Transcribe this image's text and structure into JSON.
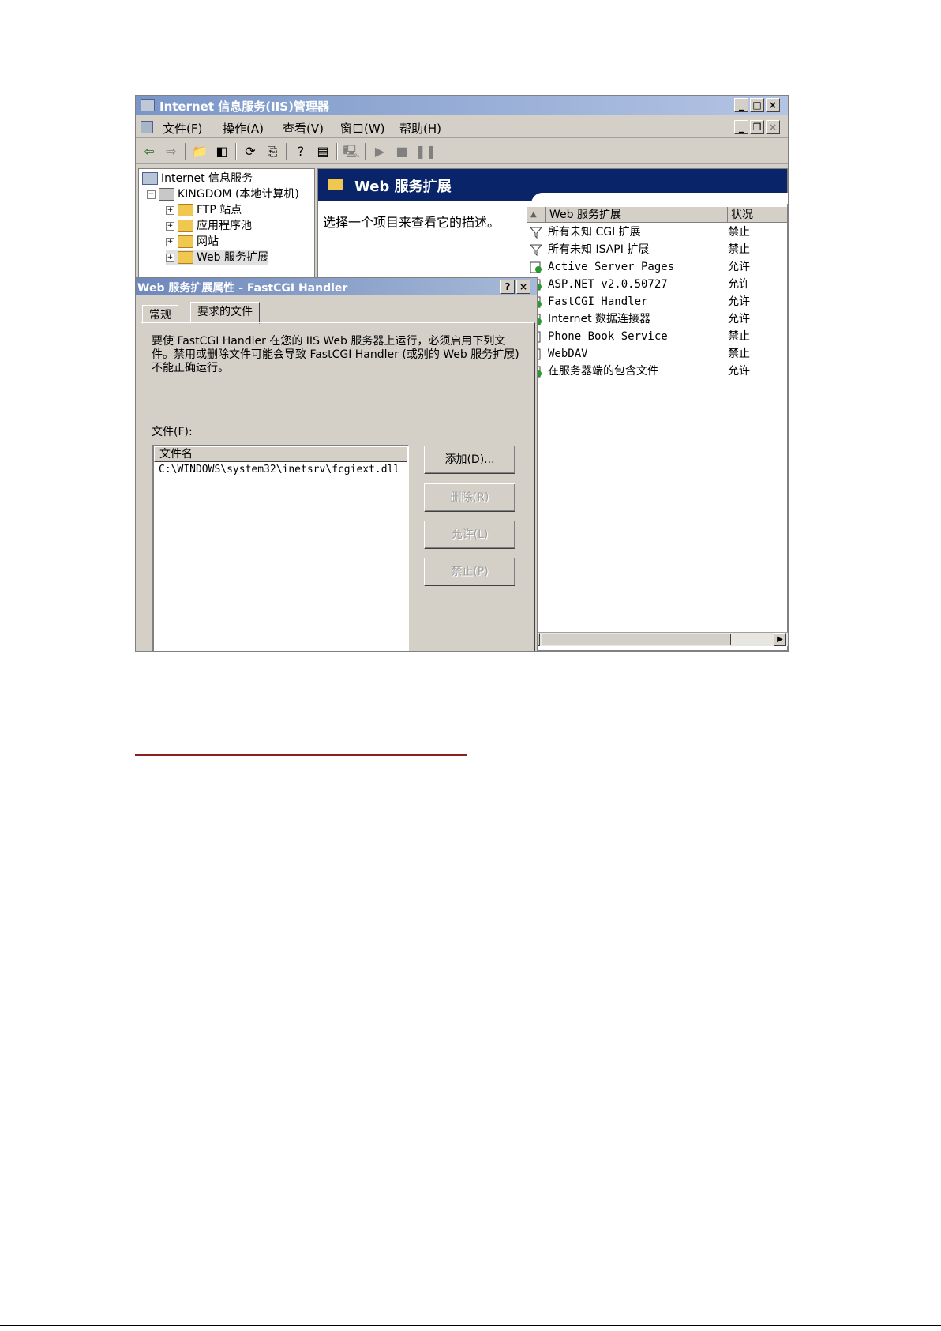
{
  "main_window": {
    "title": "Internet 信息服务(IIS)管理器",
    "caption_buttons": {
      "minimize": "_",
      "maximize": "□",
      "close": "×"
    },
    "mdi_buttons": {
      "minimize": "_",
      "restore": "❐",
      "close": "×"
    },
    "menu": [
      "文件(F)",
      "操作(A)",
      "查看(V)",
      "窗口(W)",
      "帮助(H)"
    ],
    "toolbar_icons": [
      "back-icon",
      "forward-icon",
      "up-folder-icon",
      "show-hide-tree-icon",
      "refresh-icon",
      "export-list-icon",
      "help-icon",
      "properties-icon",
      "connect-icon",
      "play-icon",
      "stop-icon",
      "pause-icon"
    ]
  },
  "tree": {
    "root": "Internet 信息服务",
    "computer": "KINGDOM (本地计算机)",
    "children": [
      "FTP 站点",
      "应用程序池",
      "网站",
      "Web 服务扩展"
    ]
  },
  "right_pane": {
    "banner_title": "Web 服务扩展",
    "description": "选择一个项目来查看它的描述。",
    "columns": [
      "Web 服务扩展",
      "状况"
    ],
    "rows": [
      {
        "name": "所有未知 CGI 扩展",
        "status": "禁止",
        "icon": "filter-icon"
      },
      {
        "name": "所有未知 ISAPI 扩展",
        "status": "禁止",
        "icon": "filter-icon"
      },
      {
        "name": "Active Server Pages",
        "status": "允许",
        "icon": "allowed-extension-icon"
      },
      {
        "name": "ASP.NET v2.0.50727",
        "status": "允许",
        "icon": "allowed-extension-icon"
      },
      {
        "name": "FastCGI Handler",
        "status": "允许",
        "icon": "allowed-extension-icon"
      },
      {
        "name": "Internet 数据连接器",
        "status": "允许",
        "icon": "allowed-extension-icon"
      },
      {
        "name": "Phone Book Service",
        "status": "禁止",
        "icon": "prohibited-extension-icon"
      },
      {
        "name": "WebDAV",
        "status": "禁止",
        "icon": "prohibited-extension-icon"
      },
      {
        "name": "在服务器端的包含文件",
        "status": "允许",
        "icon": "allowed-extension-icon"
      }
    ]
  },
  "dialog": {
    "title": "Web 服务扩展属性 - FastCGI Handler",
    "help_button": "?",
    "close_button": "×",
    "tabs": [
      "常规",
      "要求的文件"
    ],
    "description": "要使 FastCGI Handler 在您的 IIS Web 服务器上运行，必须启用下列文件。禁用或删除文件可能会导致 FastCGI Handler (或别的 Web 服务扩展) 不能正确运行。",
    "files_label": "文件(F):",
    "files_column": "文件名",
    "files": [
      "C:\\WINDOWS\\system32\\inetsrv\\fcgiext.dll"
    ],
    "buttons": {
      "add": "添加(D)...",
      "remove": "删除(R)",
      "allow": "允许(L)",
      "prohibit": "禁止(P)"
    }
  }
}
